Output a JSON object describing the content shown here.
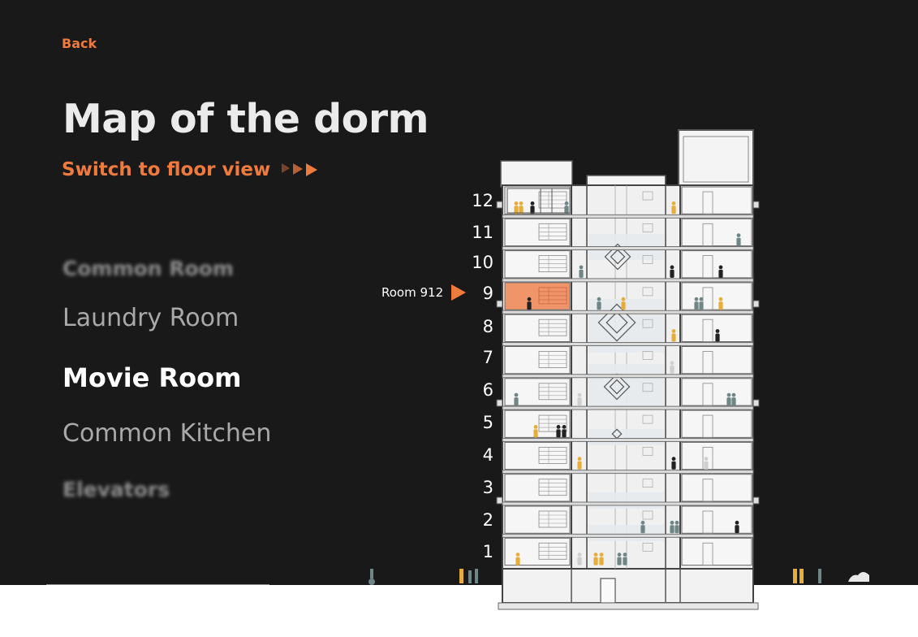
{
  "nav": {
    "back_label": "Back"
  },
  "page": {
    "title": "Map of the dorm",
    "switch_label": "Switch to floor view"
  },
  "rooms": [
    {
      "label": "Common Room",
      "state": "blurred"
    },
    {
      "label": "Laundry Room",
      "state": "inactive"
    },
    {
      "label": "Movie Room",
      "state": "active"
    },
    {
      "label": "Common Kitchen",
      "state": "inactive"
    },
    {
      "label": "Elevators",
      "state": "blurred"
    }
  ],
  "building": {
    "floors": [
      "12",
      "11",
      "10",
      "9",
      "8",
      "7",
      "6",
      "5",
      "4",
      "3",
      "2",
      "1"
    ],
    "highlight_label": "Room 912",
    "highlight_floor": "9"
  },
  "colors": {
    "background": "#1a1919",
    "accent": "#ef7a3d",
    "highlight_room": "#f0956a",
    "person_yellow": "#e6ad3a",
    "person_teal": "#6f8687",
    "person_dark": "#222222"
  }
}
